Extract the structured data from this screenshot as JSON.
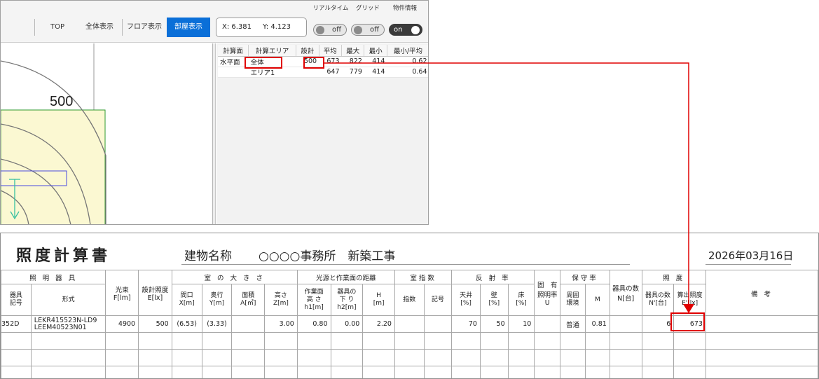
{
  "toolbar": {
    "buttons": [
      "TOP",
      "全体表示",
      "フロア表示",
      "部屋表示"
    ],
    "coord_x": "X: 6.381",
    "coord_y": "Y: 4.123",
    "realtime_label": "リアルタイム",
    "realtime_state": "off",
    "grid_label": "グリッド",
    "grid_state": "off",
    "property_label": "物件情報",
    "property_state": "on"
  },
  "drawing": {
    "contour_label": "500"
  },
  "results": {
    "headers": [
      "計算面",
      "計算エリア",
      "設計",
      "平均",
      "最大",
      "最小",
      "最小/平均"
    ],
    "rows": [
      [
        "水平面",
        "全体",
        "500",
        "673",
        "822",
        "414",
        "0.62"
      ],
      [
        "",
        "エリア1",
        "",
        "647",
        "779",
        "414",
        "0.64"
      ]
    ]
  },
  "report": {
    "title": "照度計算書",
    "building_label": "建物名称",
    "building_name": "○○○○事務所　新築工事",
    "date": "2026年03月16日",
    "groups": {
      "luminaire": "照 明 器 具",
      "room_size": "室 の 大 き さ",
      "distance": "光源と作業面の距離",
      "room_index": "室指数",
      "reflectance": "反 射 率",
      "maintenance": "保守率",
      "illuminance": "照 度",
      "remarks": "備 考"
    },
    "sub": {
      "symbol": "器具\n記号",
      "model": "形式",
      "flux": "光束\nF[lm]",
      "design_illum": "設計照度\nE[lx]",
      "width": "間口\nX[m]",
      "depth": "奥行\nY[m]",
      "area": "面積\nA[㎡]",
      "height": "高さ\nZ[m]",
      "work_height": "作業面\n高 さ\nh1[m]",
      "hang": "器具の\n下 り\nh2[m]",
      "h": "H\n[m]",
      "index": "指数",
      "index_mark": "記号",
      "ceiling": "天井\n[%]",
      "wall": "壁\n[%]",
      "floor": "床\n[%]",
      "utilization": "固　有\n照明率\nU",
      "environment": "周囲\n環境",
      "m": "M",
      "count_n": "器具の数\nN[台]",
      "count_n2": "器具の数\nN'[台]",
      "calc_illum": "算出照度\nE'[lx]"
    },
    "row": {
      "symbol": "352D",
      "model": "LEKR415523N-LD9\nLEEM40523N01",
      "flux": "4900",
      "design_illum": "500",
      "width": "(6.53)",
      "depth": "(3.33)",
      "area": "",
      "height": "3.00",
      "work_height": "0.80",
      "hang": "0.00",
      "h": "2.20",
      "ceiling": "70",
      "wall": "50",
      "floor": "10",
      "environment": "普通",
      "m": "0.81",
      "count_n2": "6",
      "calc_illum": "673"
    }
  },
  "colors": {
    "accent": "#0a6fd8",
    "highlight": "#e00000",
    "contour_fill": "#fbf8d2",
    "contour_border": "#2e9a2e"
  }
}
